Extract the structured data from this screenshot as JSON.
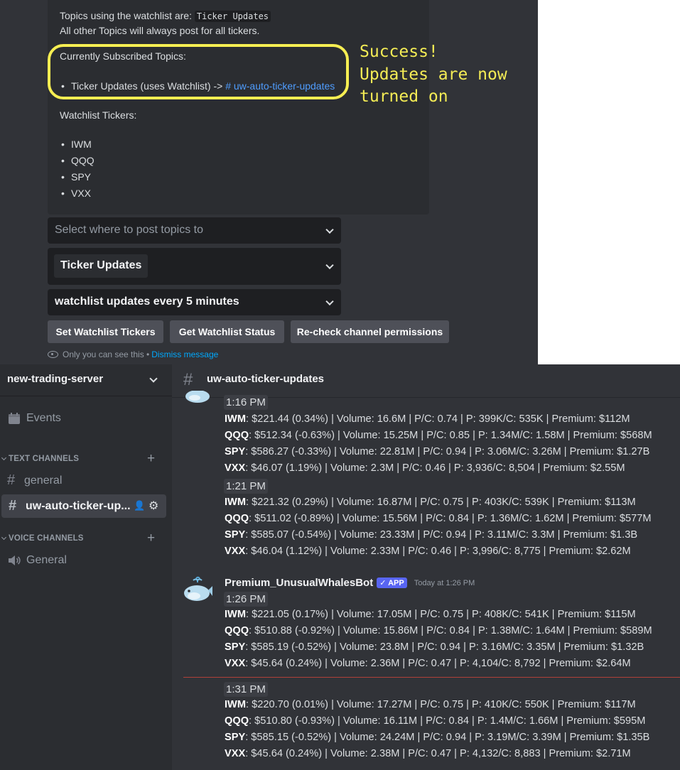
{
  "embed": {
    "line1_prefix": "Topics using the watchlist are:",
    "line1_code": "Ticker Updates",
    "line2": "All other Topics will always post for all tickers.",
    "subscribed_header": "Currently Subscribed Topics:",
    "subscribed_item": "Ticker Updates (uses Watchlist) ->",
    "subscribed_channel": "# uw-auto-ticker-updates",
    "watchlist_header": "Watchlist Tickers:",
    "tickers": [
      "IWM",
      "QQQ",
      "SPY",
      "VXX"
    ]
  },
  "annotation": {
    "line1": "Success!",
    "line2": "Updates are now",
    "line3": "turned on",
    "color": "#f6ee52"
  },
  "controls": {
    "select_post_placeholder": "Select where to post topics to",
    "select_topic_value": "Ticker Updates",
    "select_interval_value": "watchlist updates every 5 minutes",
    "btn_set": "Set Watchlist Tickers",
    "btn_get": "Get Watchlist Status",
    "btn_recheck": "Re-check channel permissions",
    "ephemeral_text": "Only you can see this •",
    "dismiss": "Dismiss message"
  },
  "sidebar": {
    "server_name": "new-trading-server",
    "events": "Events",
    "text_category": "TEXT CHANNELS",
    "channels": [
      "general",
      "uw-auto-ticker-up..."
    ],
    "voice_category": "VOICE CHANNELS",
    "voice_channels": [
      "General"
    ]
  },
  "channel": {
    "name": "uw-auto-ticker-updates",
    "author": "Premium_UnusualWhalesBot",
    "app_badge": "✓ APP",
    "timestamp": "Today at 1:26 PM",
    "groups": [
      {
        "time": "1:16 PM",
        "rows": [
          {
            "t": "IWM",
            "rest": ": $221.44 (0.34%) | Volume: 16.6M | P/C: 0.74 | P: 399K/C: 535K | Premium: $112M"
          },
          {
            "t": "QQQ",
            "rest": ": $512.34 (-0.63%) | Volume: 15.25M | P/C: 0.85 | P: 1.34M/C: 1.58M | Premium: $568M"
          },
          {
            "t": "SPY",
            "rest": ": $586.27 (-0.33%) | Volume: 22.81M | P/C: 0.94 | P: 3.06M/C: 3.26M | Premium: $1.27B"
          },
          {
            "t": "VXX",
            "rest": ": $46.07 (1.19%) | Volume: 2.3M | P/C: 0.46 | P: 3,936/C: 8,504 | Premium: $2.55M"
          }
        ]
      },
      {
        "time": "1:21 PM",
        "rows": [
          {
            "t": "IWM",
            "rest": ": $221.32 (0.29%) | Volume: 16.87M | P/C: 0.75 | P: 403K/C: 539K | Premium: $113M"
          },
          {
            "t": "QQQ",
            "rest": ": $511.02 (-0.89%) | Volume: 15.56M | P/C: 0.84 | P: 1.36M/C: 1.62M | Premium: $577M"
          },
          {
            "t": "SPY",
            "rest": ": $585.07 (-0.54%) | Volume: 23.33M | P/C: 0.94 | P: 3.11M/C: 3.3M | Premium: $1.3B"
          },
          {
            "t": "VXX",
            "rest": ": $46.04 (1.12%) | Volume: 2.33M | P/C: 0.46 | P: 3,996/C: 8,775 | Premium: $2.62M"
          }
        ]
      },
      {
        "time": "1:26 PM",
        "rows": [
          {
            "t": "IWM",
            "rest": ": $221.05 (0.17%) | Volume: 17.05M | P/C: 0.75 | P: 408K/C: 541K | Premium: $115M"
          },
          {
            "t": "QQQ",
            "rest": ": $510.88 (-0.92%) | Volume: 15.86M | P/C: 0.84 | P: 1.38M/C: 1.64M | Premium: $589M"
          },
          {
            "t": "SPY",
            "rest": ": $585.19 (-0.52%) | Volume: 23.8M | P/C: 0.94 | P: 3.16M/C: 3.35M | Premium: $1.32B"
          },
          {
            "t": "VXX",
            "rest": ": $45.64 (0.24%) | Volume: 2.36M | P/C: 0.47 | P: 4,104/C: 8,792 | Premium: $2.64M"
          }
        ]
      },
      {
        "time": "1:31 PM",
        "rows": [
          {
            "t": "IWM",
            "rest": ": $220.70 (0.01%) | Volume: 17.27M | P/C: 0.75 | P: 410K/C: 550K | Premium: $117M"
          },
          {
            "t": "QQQ",
            "rest": ": $510.80 (-0.93%) | Volume: 16.11M | P/C: 0.84 | P: 1.4M/C: 1.66M | Premium: $595M"
          },
          {
            "t": "SPY",
            "rest": ": $585.15 (-0.52%) | Volume: 24.24M | P/C: 0.94 | P: 3.19M/C: 3.39M | Premium: $1.35B"
          },
          {
            "t": "VXX",
            "rest": ": $45.64 (0.24%) | Volume: 2.38M | P/C: 0.47 | P: 4,132/C: 8,883 | Premium: $2.71M"
          }
        ]
      }
    ]
  },
  "colors": {
    "background": "#313338",
    "sidebar": "#2b2d31",
    "link": "#4f9dff",
    "accent": "#5865f2",
    "new_divider": "#b0413a"
  }
}
